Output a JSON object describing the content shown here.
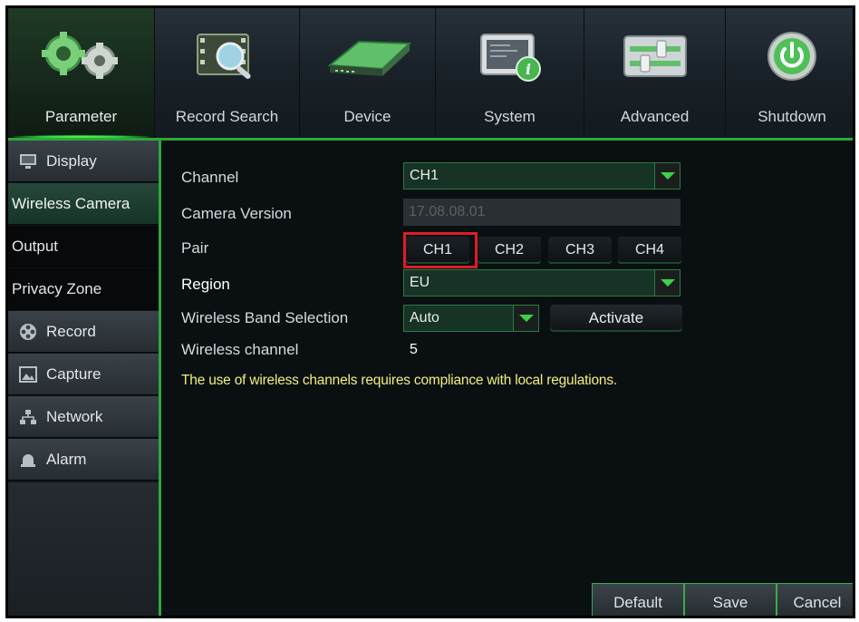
{
  "nav": {
    "tabs": [
      {
        "label": "Parameter",
        "icon": "gears-icon",
        "active": true
      },
      {
        "label": "Record Search",
        "icon": "film-search-icon",
        "active": false
      },
      {
        "label": "Device",
        "icon": "hard-drive-icon",
        "active": false
      },
      {
        "label": "System",
        "icon": "system-info-icon",
        "active": false
      },
      {
        "label": "Advanced",
        "icon": "sliders-icon",
        "active": false
      },
      {
        "label": "Shutdown",
        "icon": "power-icon",
        "active": false
      }
    ]
  },
  "sidebar": {
    "items": [
      {
        "label": "Display",
        "type": "category",
        "icon": "monitor-icon"
      },
      {
        "label": "Wireless Camera",
        "type": "sub",
        "selected": true
      },
      {
        "label": "Output",
        "type": "sub"
      },
      {
        "label": "Privacy Zone",
        "type": "sub"
      },
      {
        "label": "Record",
        "type": "category",
        "icon": "film-reel-icon"
      },
      {
        "label": "Capture",
        "type": "category",
        "icon": "image-icon"
      },
      {
        "label": "Network",
        "type": "category",
        "icon": "network-icon"
      },
      {
        "label": "Alarm",
        "type": "category",
        "icon": "alarm-icon"
      }
    ]
  },
  "form": {
    "channel": {
      "label": "Channel",
      "value": "CH1"
    },
    "camera_version": {
      "label": "Camera Version",
      "value": "17.08.08.01"
    },
    "pair": {
      "label": "Pair",
      "buttons": [
        "CH1",
        "CH2",
        "CH3",
        "CH4"
      ],
      "highlighted": "CH1"
    },
    "region": {
      "label": "Region",
      "value": "EU"
    },
    "band": {
      "label": "Wireless Band Selection",
      "value": "Auto",
      "activate_label": "Activate"
    },
    "wireless_channel": {
      "label": "Wireless channel",
      "value": "5"
    },
    "notice": "The use of wireless channels requires compliance with local regulations."
  },
  "footer": {
    "default_label": "Default",
    "save_label": "Save",
    "cancel_label": "Cancel"
  },
  "colors": {
    "accent": "#2da93a",
    "highlight": "#e01b24",
    "notice": "#f2f07a"
  }
}
